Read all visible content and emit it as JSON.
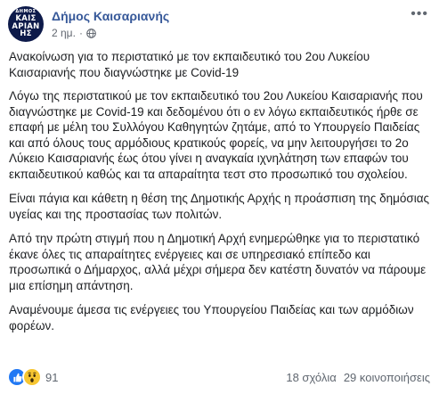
{
  "page": {
    "name": "Δήμος Καισαριανής",
    "time": "2 ημ.",
    "logo": {
      "top": "ΔΗΜΟΣ",
      "line1": "ΚΑΙΣ",
      "line2": "ΑΡΙΑΝ",
      "line3": "ΗΣ"
    }
  },
  "post": {
    "title": "Ανακοίνωση για το περιστατικό με τον εκπαιδευτικό του 2ου Λυκείου Καισαριανής που διαγνώστηκε με Covid-19",
    "paragraphs": [
      "Λόγω της περιστατικού με τον εκπαιδευτικό του 2ου Λυκείου Καισαριανής που διαγνώστηκε με Covid-19 και δεδομένου ότι ο εν λόγω εκπαιδευτικός ήρθε σε επαφή με μέλη του Συλλόγου Καθηγητών ζητάμε, από το Υπουργείο Παιδείας και από όλους τους αρμόδιους κρατικούς φορείς, να μην λειτουργήσει το 2ο Λύκειο Καισαριανής έως ότου γίνει η αναγκαία ιχνηλάτηση των επαφών του εκπαιδευτικού καθώς και τα απαραίτητα τεστ στο προσωπικό του σχολείου.",
      "Είναι πάγια και κάθετη η θέση της Δημοτικής Αρχής η προάσπιση της δημόσιας υγείας και της προστασίας των πολιτών.",
      "Από την πρώτη στιγμή που η Δημοτική Αρχή ενημερώθηκε για το περιστατικό έκανε όλες τις απαραίτητες ενέργειες και σε υπηρεσιακό επίπεδο και προσωπικά ο Δήμαρχος, αλλά μέχρι σήμερα δεν κατέστη δυνατόν να πάρουμε μια επίσημη απάντηση.",
      "Αναμένουμε άμεσα τις ενέργειες του Υπουργείου Παιδείας και των αρμόδιων φορέων."
    ]
  },
  "footer": {
    "reaction_count": "91",
    "comments": "18 σχόλια",
    "shares": "29 κοινοποιήσεις"
  },
  "colors": {
    "link": "#365899",
    "meta": "#616770",
    "like": "#2078f4",
    "wow": "#f7c631"
  },
  "icons": {
    "privacy": "globe-icon",
    "menu": "more-options-icon",
    "reaction1": "like-reaction-icon",
    "reaction2": "wow-reaction-icon"
  }
}
